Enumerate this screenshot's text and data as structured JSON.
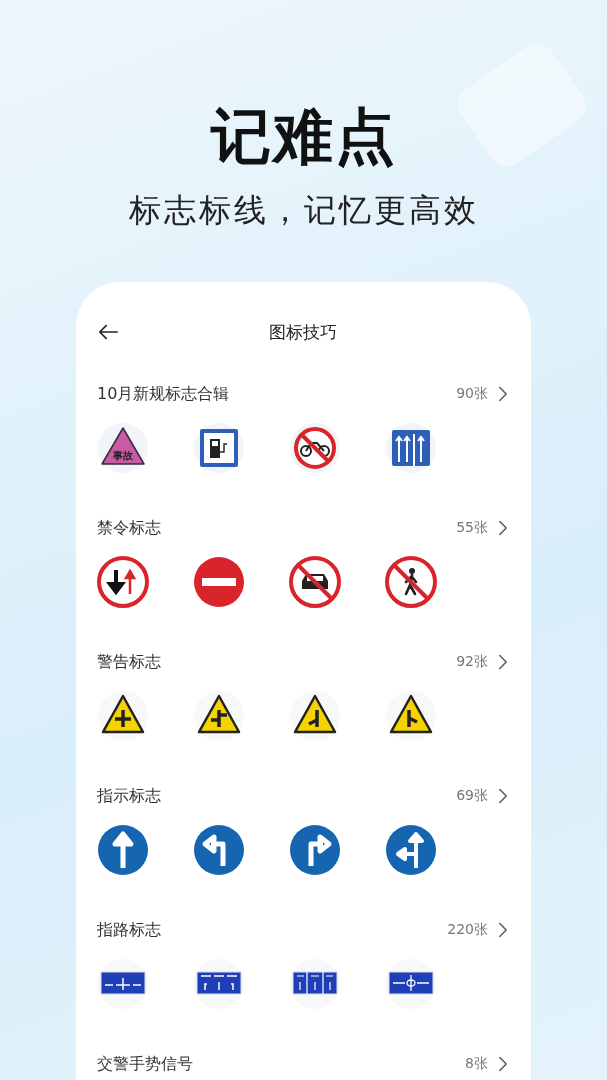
{
  "hero": {
    "title": "记难点",
    "subtitle": "标志标线，记忆更高效"
  },
  "nav": {
    "title": "图标技巧"
  },
  "sections": [
    {
      "title": "10月新规标志合辑",
      "count": "90张",
      "signs": [
        {
          "kind": "accident",
          "label": "事故"
        },
        {
          "kind": "charging"
        },
        {
          "kind": "no-moto"
        },
        {
          "kind": "lanes"
        }
      ]
    },
    {
      "title": "禁令标志",
      "count": "55张",
      "signs": [
        {
          "kind": "priority"
        },
        {
          "kind": "no-entry"
        },
        {
          "kind": "no-car"
        },
        {
          "kind": "no-pedestrian"
        }
      ]
    },
    {
      "title": "警告标志",
      "count": "92张",
      "signs": [
        {
          "kind": "warn-cross"
        },
        {
          "kind": "warn-staggered"
        },
        {
          "kind": "warn-merge-left"
        },
        {
          "kind": "warn-merge-right"
        }
      ]
    },
    {
      "title": "指示标志",
      "count": "69张",
      "signs": [
        {
          "kind": "arrow-straight"
        },
        {
          "kind": "arrow-left"
        },
        {
          "kind": "arrow-right"
        },
        {
          "kind": "arrow-straight-left"
        }
      ]
    },
    {
      "title": "指路标志",
      "count": "220张",
      "signs": [
        {
          "kind": "guide-cross"
        },
        {
          "kind": "guide-three"
        },
        {
          "kind": "guide-panels"
        },
        {
          "kind": "guide-roundabout"
        }
      ]
    },
    {
      "title": "交警手势信号",
      "count": "8张"
    }
  ]
}
